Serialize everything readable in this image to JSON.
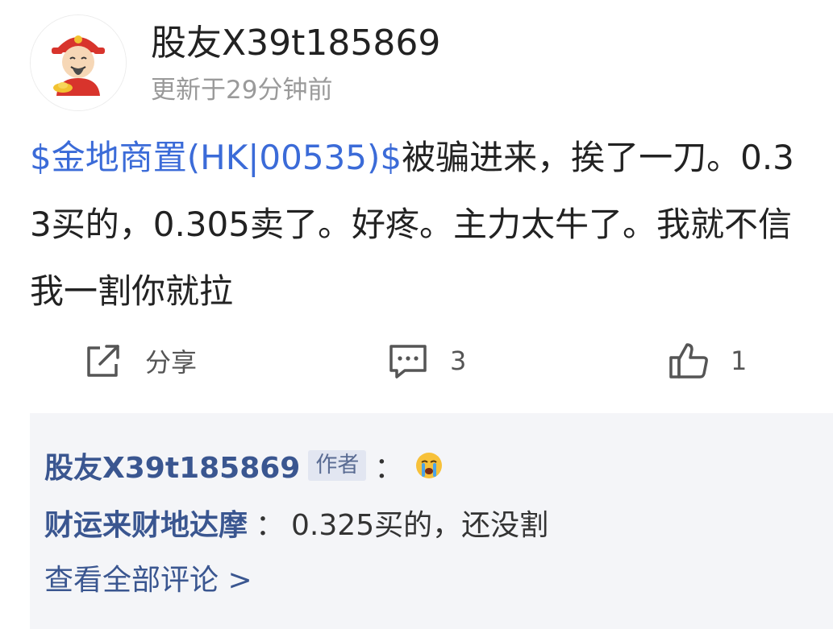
{
  "post": {
    "author": "股友X39t185869",
    "timestamp": "更新于29分钟前",
    "stock_link": "$金地商置(HK|00535)$",
    "content_text": "被骗进来，挨了一刀。0.33买的，0.305卖了。好疼。主力太牛了。我就不信我一割你就拉"
  },
  "actions": {
    "share_label": "分享",
    "comment_count": "3",
    "like_count": "1"
  },
  "comments": {
    "items": [
      {
        "user": "股友X39t185869",
        "badge": "作者",
        "separator": "：",
        "text": "",
        "emoji": "crying-face"
      },
      {
        "user": "财运来财地达摩",
        "separator": "：",
        "text": "0.325买的，还没割"
      }
    ],
    "view_all_label": "查看全部评论 >"
  },
  "colors": {
    "link_blue": "#3b6bd8",
    "comment_user": "#3a5690",
    "panel_bg": "#f4f5f8",
    "timestamp_gray": "#9a9a9a"
  }
}
